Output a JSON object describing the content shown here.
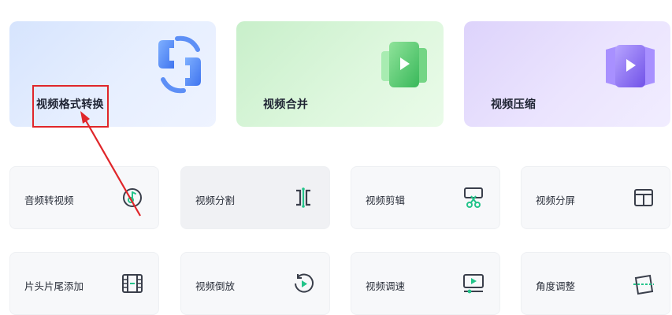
{
  "featured_tools": [
    {
      "label": "视频格式转换",
      "icon": "format-convert-icon"
    },
    {
      "label": "视频合并",
      "icon": "video-merge-icon"
    },
    {
      "label": "视频压缩",
      "icon": "video-compress-icon"
    }
  ],
  "tools_row1": [
    {
      "label": "音频转视频",
      "icon": "audio-to-video-icon"
    },
    {
      "label": "视频分割",
      "icon": "video-split-icon"
    },
    {
      "label": "视频剪辑",
      "icon": "video-cut-icon"
    },
    {
      "label": "视频分屏",
      "icon": "split-screen-icon"
    }
  ],
  "tools_row2": [
    {
      "label": "片头片尾添加",
      "icon": "intro-outro-icon"
    },
    {
      "label": "视频倒放",
      "icon": "reverse-play-icon"
    },
    {
      "label": "视频调速",
      "icon": "speed-adjust-icon"
    },
    {
      "label": "角度调整",
      "icon": "rotate-angle-icon"
    }
  ],
  "colors": {
    "accent_green": "#23c48a",
    "icon_dark": "#3a3f4b",
    "annotation_red": "#e0262a",
    "format_blue": "#4f86f7",
    "merge_green": "#4cc96a",
    "compress_purple": "#8b6cf2"
  }
}
